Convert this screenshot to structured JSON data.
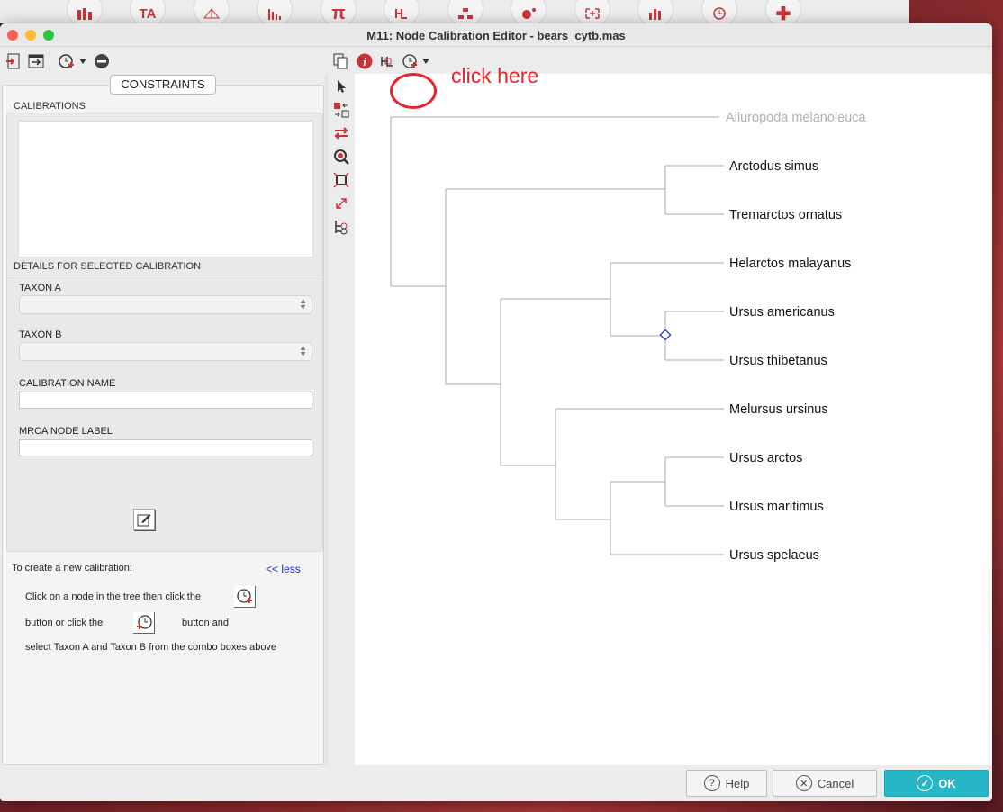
{
  "window": {
    "title": "M11: Node Calibration Editor - bears_cytb.mas",
    "traffic_colors": [
      "#fe5f57",
      "#febc2e",
      "#28c840"
    ]
  },
  "background_toolbar": {
    "icons": [
      "bar-chart-icon",
      "ta-icon",
      "network-icon",
      "histogram-icon",
      "pi-icon",
      "tree-icon",
      "hierarchy-icon",
      "scatter-icon",
      "target-icon",
      "column-chart-icon",
      "clock-icon",
      "plus-icon"
    ],
    "ta_label": "TA",
    "pi_label": "π",
    "plus_label": "✚"
  },
  "left_panel": {
    "tab_label": "CONSTRAINTS",
    "calibrations_label": "CALIBRATIONS",
    "details_label": "DETAILS FOR SELECTED CALIBRATION",
    "taxon_a_label": "TAXON A",
    "taxon_b_label": "TAXON B",
    "calibration_name_label": "CALIBRATION NAME",
    "mrca_label": "MRCA NODE LABEL",
    "help": {
      "heading": "To create a new calibration:",
      "less_link": "<< less",
      "line1": "Click on a node in the tree then click the",
      "line2a": "button or click the",
      "line2b": "button and",
      "line3": "select Taxon A and Taxon B from the combo boxes above"
    }
  },
  "annotation": {
    "text": "click here",
    "color": "#e8242a"
  },
  "tree": {
    "taxa": [
      {
        "name": "Ailuropoda melanoleuca",
        "dimmed": true
      },
      {
        "name": "Arctodus simus",
        "dimmed": false
      },
      {
        "name": "Tremarctos ornatus",
        "dimmed": false
      },
      {
        "name": "Helarctos malayanus",
        "dimmed": false
      },
      {
        "name": "Ursus americanus",
        "dimmed": false
      },
      {
        "name": "Ursus thibetanus",
        "dimmed": false
      },
      {
        "name": "Melursus ursinus",
        "dimmed": false
      },
      {
        "name": "Ursus arctos",
        "dimmed": false
      },
      {
        "name": "Ursus maritimus",
        "dimmed": false
      },
      {
        "name": "Ursus spelaeus",
        "dimmed": false
      }
    ],
    "selected_node_color": "#1a2fd6"
  },
  "buttons": {
    "help": "Help",
    "cancel": "Cancel",
    "ok": "OK",
    "help_glyph": "?",
    "cancel_glyph": "✕",
    "ok_glyph": "✓"
  },
  "colors": {
    "accent_red": "#c9343b",
    "ok_teal": "#27b6c6"
  }
}
